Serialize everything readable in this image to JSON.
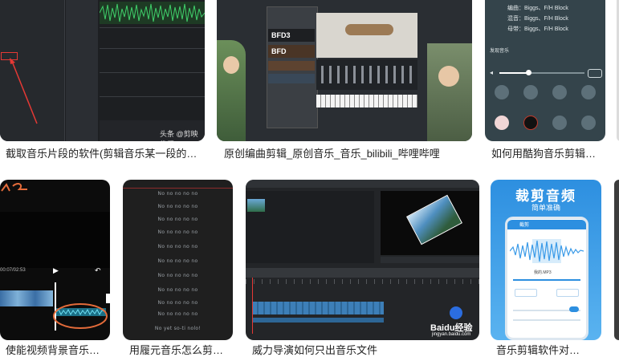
{
  "results": [
    {
      "caption": "截取音乐片段的软件(剪辑音乐某一段的…",
      "watermark": "头条 @剪映教程"
    },
    {
      "caption": "原创编曲剪辑_原创音乐_音乐_bilibili_哔哩哔哩",
      "plugin_labels": [
        "BFD3",
        "BFD"
      ]
    },
    {
      "caption": "如何用酷狗音乐剪辑…",
      "credits": [
        "编曲：Biggs、F/H Block",
        "混音：Biggs、F/H Block",
        "母带：Biggs、F/H Block"
      ],
      "screen_label": "发现音乐"
    },
    {
      "caption": "使能视频背景音乐…",
      "timecode": "00:07/02:53"
    },
    {
      "caption": "用履元音乐怎么剪…",
      "lyrics": [
        "No no no no no",
        "No no no no no",
        "No no no no no",
        "No no no no no",
        "No no no no no",
        "No no no no no",
        "No no no no no",
        "No no no no no",
        "No no no no no",
        "No no no no no",
        "No yet so-ti nolo!"
      ]
    },
    {
      "caption": "威力导演如何只出音乐文件",
      "watermark": "Baidu经验",
      "watermark_sub": "jingyan.baidu.com"
    },
    {
      "caption": "音乐剪辑软件对…",
      "headline": "裁剪音频",
      "subheadline": "简单准确",
      "app_title": "截剪",
      "file_label": "我的.MP3"
    }
  ]
}
